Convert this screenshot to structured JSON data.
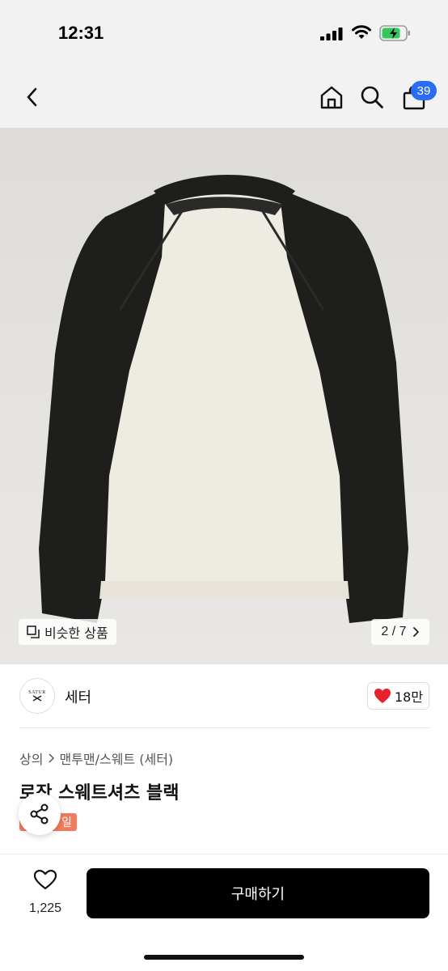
{
  "status_bar": {
    "time": "12:31"
  },
  "nav": {
    "cart_count": "39"
  },
  "product_image": {
    "similar_label": "비슷한 상품",
    "page_indicator": "2 / 7"
  },
  "store": {
    "logo_text": "SATUR",
    "name": "세터",
    "likes": "18만"
  },
  "breadcrumb": {
    "category": "상의",
    "subcategory": "맨투맨/스웨트 (세터)"
  },
  "product": {
    "title": "로잔 스웨트셔츠 블랙",
    "tag": "일"
  },
  "bottom_bar": {
    "wish_count": "1,225",
    "buy_label": "구매하기"
  },
  "colors": {
    "badge": "#2b6cf6",
    "tag": "#f47a5c",
    "heart": "#e8202e",
    "buy_button": "#000000"
  }
}
